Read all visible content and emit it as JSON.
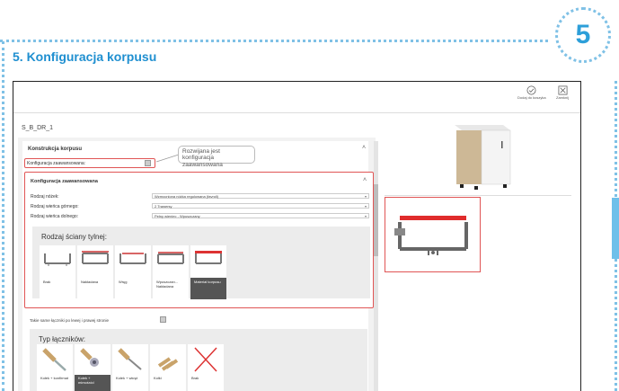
{
  "badge": {
    "number": "5"
  },
  "page_title": "5. Konfiguracja korpusu",
  "toolbar": {
    "add_to_cart_label": "Dodaj do koszyka",
    "close_label": "Zamknij"
  },
  "cabinet_code": "S_B_DR_1",
  "construction": {
    "section_title": "Konstrukcja korpusu",
    "advanced_config_label": "Konfiguracja zaawansowana:",
    "callout_text": "Rozwijana jest konfiguracja zaawansowana"
  },
  "advanced": {
    "title": "Konfiguracja zaawansowana",
    "rows": [
      {
        "label": "Rodzaj nóżek:",
        "value": "Wzmocniona nóżka regulowana (favroll)"
      },
      {
        "label": "Rodzaj wieńca górnego:",
        "value": "2 Trawersy"
      },
      {
        "label": "Rodzaj wieńca dolnego:",
        "value": "Pełny wieniec - Wpuszczany"
      }
    ]
  },
  "back_wall": {
    "title": "Rodzaj ściany tylnej:",
    "options": [
      {
        "label": "Brak"
      },
      {
        "label": "Nakładana"
      },
      {
        "label": "Wręg"
      },
      {
        "label": "Wpuszczan... Nakładana"
      },
      {
        "label": "Materiał korpusu",
        "selected": true
      }
    ]
  },
  "same_connectors_label": "Takie same łączniki po lewej i prawej stronie",
  "connectors": {
    "title": "Typ łączników:",
    "options": [
      {
        "label": "Kołek + konfirmat"
      },
      {
        "label": "Kołek + mimośród",
        "selected": true
      },
      {
        "label": "Kołek + wkręt"
      },
      {
        "label": "Kołki"
      },
      {
        "label": "Brak"
      }
    ]
  },
  "colors": {
    "accent": "#1f8fd0",
    "highlight": "#e05555",
    "dots": "#7fc1e6"
  }
}
